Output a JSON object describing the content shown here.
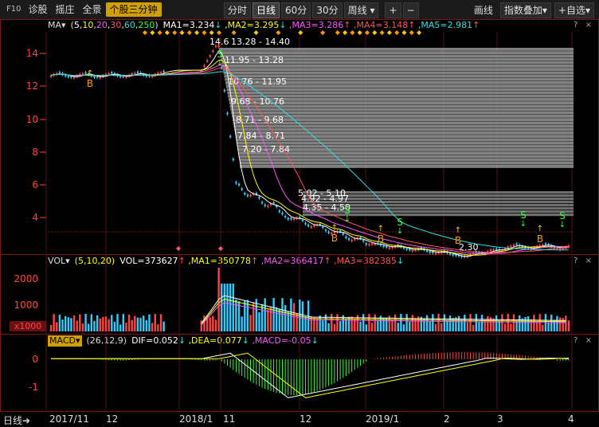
{
  "toolbar": {
    "left": [
      {
        "id": "f10",
        "label": "F10"
      },
      {
        "id": "diagnose",
        "label": "诊股"
      },
      {
        "id": "screen",
        "label": "摇庄"
      },
      {
        "id": "overview",
        "label": "全景"
      },
      {
        "id": "stock3min",
        "label": "个股三分钟"
      }
    ],
    "periods": [
      {
        "id": "fenshi",
        "label": "分时"
      },
      {
        "id": "rixian",
        "label": "日线"
      },
      {
        "id": "m60",
        "label": "60分"
      },
      {
        "id": "m30",
        "label": "30分"
      },
      {
        "id": "zhouxian",
        "label": "周线"
      }
    ],
    "zoom_in": "+",
    "zoom_out": "−",
    "right": [
      {
        "id": "draw",
        "label": "画线"
      },
      {
        "id": "indexoverlay",
        "label": "指数叠加"
      },
      {
        "id": "addselect",
        "label": "+自选"
      }
    ]
  },
  "ma": {
    "name": "MA",
    "params_open": "(",
    "params": [
      {
        "v": "5",
        "c": "#ffffff"
      },
      {
        "v": "10",
        "c": "#ffff00"
      },
      {
        "v": "20",
        "c": "#ff55ff"
      },
      {
        "v": "30",
        "c": "#ff5555"
      },
      {
        "v": "60",
        "c": "#33dddd"
      },
      {
        "v": "250",
        "c": "#33ff33"
      }
    ],
    "params_close": ")",
    "values": [
      {
        "label": "MA1=3.234",
        "arrow": "↓",
        "c": "#ffffff",
        "ac": "#33dddd"
      },
      {
        "label": ",MA2=3.295",
        "arrow": "↓",
        "c": "#ffff00",
        "ac": "#33dddd"
      },
      {
        "label": ",MA3=3.286",
        "arrow": "↑",
        "c": "#ff55ff",
        "ac": "#ff5555"
      },
      {
        "label": ",MA4=3.148",
        "arrow": "↑",
        "c": "#ff5555",
        "ac": "#ff5555"
      },
      {
        "label": ",MA5=2.981",
        "arrow": "↑",
        "c": "#33dddd",
        "ac": "#ff5555"
      }
    ]
  },
  "price_axis": {
    "ticks": [
      "14",
      "12",
      "10",
      "8",
      "6",
      "4"
    ]
  },
  "chips": [
    "13.28 - 14.40",
    "11.95 - 13.28",
    "10.76 - 11.95",
    "9.68 - 10.76",
    "8.71 - 9.68",
    "7.84 - 8.71",
    "7.20 - 7.84",
    "5.02 - 5.10",
    "4.92 - 4.97",
    "4.35 - 4.50"
  ],
  "price_labels": {
    "peak": "14.6",
    "low": "2.30"
  },
  "signals": {
    "buy": "B",
    "sell": "S"
  },
  "vol": {
    "name": "VOL",
    "params": "(5,10,20)",
    "values": [
      {
        "label": "VOL=373627",
        "arrow": "↑",
        "c": "#ffffff",
        "ac": "#ff5555"
      },
      {
        "label": ",MA1=350778",
        "arrow": "↑",
        "c": "#ffff00",
        "ac": "#ff5555"
      },
      {
        "label": ",MA2=366417",
        "arrow": "↑",
        "c": "#ff55ff",
        "ac": "#ff5555"
      },
      {
        "label": ",MA3=382385",
        "arrow": "↓",
        "c": "#ff5555",
        "ac": "#33dddd"
      }
    ],
    "ticks": [
      "2000",
      "1000"
    ],
    "unit": "x1000"
  },
  "macd": {
    "name": "MACD",
    "params": "(26,12,9)",
    "values": [
      {
        "label": "DIF=0.052",
        "arrow": "↓",
        "c": "#ffffff",
        "ac": "#33dddd"
      },
      {
        "label": ",DEA=0.077",
        "arrow": "↓",
        "c": "#ffff00",
        "ac": "#33dddd"
      },
      {
        "label": ",MACD=-0.05",
        "arrow": "↓",
        "c": "#ff55ff",
        "ac": "#33dddd"
      }
    ],
    "ticks": [
      "0",
      "-1"
    ]
  },
  "help": "? ×",
  "timeframe": "日线",
  "dates": [
    "2017/11",
    "12",
    "2018/1",
    "11",
    "12",
    "2019/1",
    "2",
    "3",
    "4"
  ],
  "colors": {
    "up": "#ff4444",
    "down": "#33ccff",
    "border": "#7a1616"
  }
}
